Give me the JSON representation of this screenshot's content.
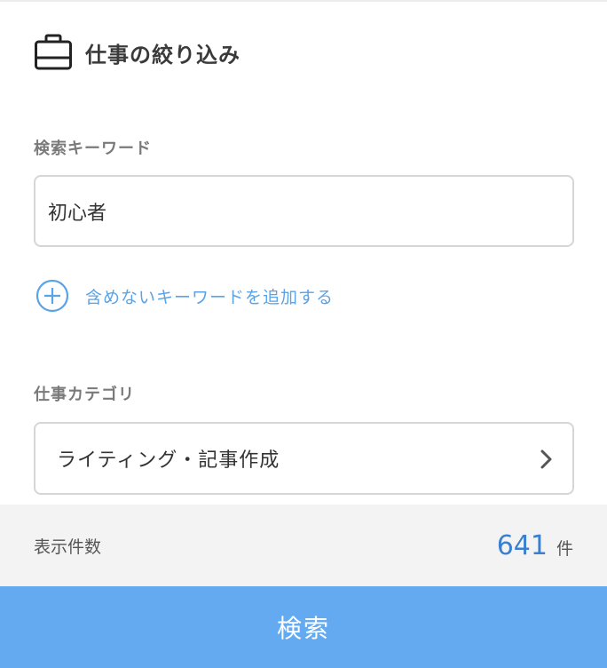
{
  "header": {
    "title": "仕事の絞り込み",
    "icon": "briefcase-icon"
  },
  "keyword": {
    "label": "検索キーワード",
    "value": "初心者"
  },
  "exclude_keyword": {
    "label": "含めないキーワードを追加する",
    "icon": "plus-circle-icon",
    "color": "#5aa3e6"
  },
  "category": {
    "label": "仕事カテゴリ",
    "value": "ライティング・記事作成",
    "icon": "chevron-right-icon"
  },
  "results": {
    "label": "表示件数",
    "count": "641",
    "unit": "件",
    "count_color": "#3b7fd0"
  },
  "search_button": {
    "label": "検索",
    "color": "#64aaf1"
  }
}
